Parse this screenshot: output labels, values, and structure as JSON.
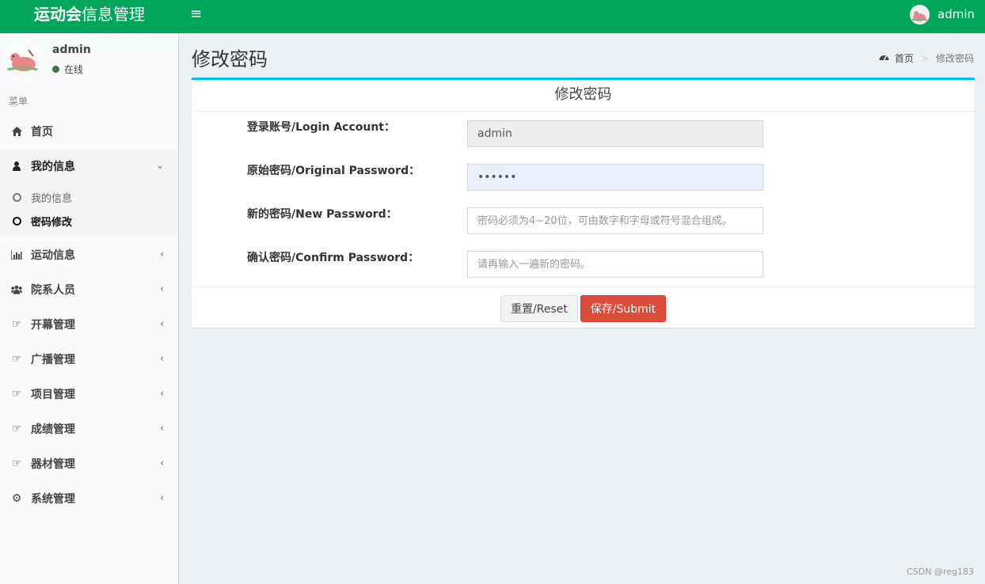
{
  "header": {
    "brand_bold": "运动会",
    "brand_rest": "信息管理",
    "toggle_icon": "hamburger-icon",
    "user_name": "admin",
    "color": "#00a65a"
  },
  "sidebar": {
    "user_name": "admin",
    "status": "在线",
    "menu_header": "菜单",
    "items": [
      {
        "label": "首页",
        "icon": "home-icon"
      },
      {
        "label": "我的信息",
        "icon": "user-icon",
        "open": true,
        "children": [
          {
            "label": "我的信息"
          },
          {
            "label": "密码修改",
            "active": true
          }
        ]
      },
      {
        "label": "运动信息",
        "icon": "bar-chart-icon"
      },
      {
        "label": "院系人员",
        "icon": "users-icon"
      },
      {
        "label": "开幕管理",
        "icon": "thumbs-up-icon"
      },
      {
        "label": "广播管理",
        "icon": "thumbs-up-icon"
      },
      {
        "label": "项目管理",
        "icon": "thumbs-up-icon"
      },
      {
        "label": "成绩管理",
        "icon": "thumbs-up-icon"
      },
      {
        "label": "器材管理",
        "icon": "thumbs-up-icon"
      },
      {
        "label": "系统管理",
        "icon": "gear-icon"
      }
    ]
  },
  "content": {
    "page_title": "修改密码",
    "breadcrumb": {
      "home": "首页",
      "current": "修改密码"
    },
    "box_title": "修改密码",
    "form": {
      "account_label": "登录账号/Login Account：",
      "account_value": "admin",
      "orig_label": "原始密码/Original Password：",
      "orig_value": "••••••",
      "new_label": "新的密码/New Password：",
      "new_placeholder": "密码必须为4~20位，可由数字和字母或符号混合组成。",
      "confirm_label": "确认密码/Confirm Password：",
      "confirm_placeholder": "请再输入一遍新的密码。"
    },
    "reset_label": "重置/Reset",
    "submit_label": "保存/Submit",
    "accent": "#00c0ef",
    "submit_color": "#dd4b39"
  },
  "watermark": "CSDN @reg183"
}
